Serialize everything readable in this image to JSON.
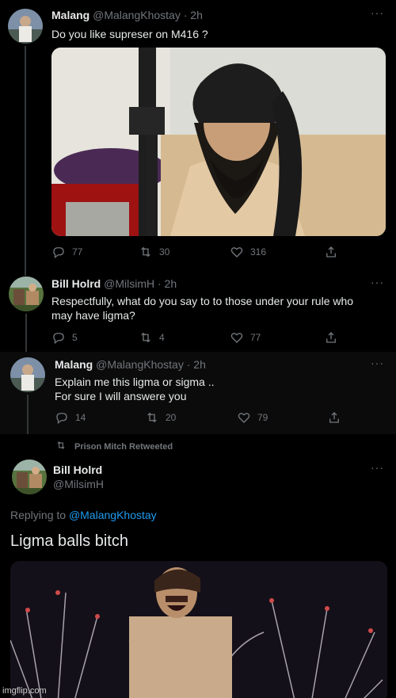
{
  "tweet1": {
    "name": "Malang",
    "handle": "@MalangKhostay",
    "time": "· 2h",
    "text": "Do you like supreser on M416 ?",
    "replies": "77",
    "retweets": "30",
    "likes": "316"
  },
  "tweet2": {
    "name": "Bill Holrd",
    "handle": "@MilsimH",
    "time": "· 2h",
    "text_line1": "Respectfully, what do you say to to those under your rule who",
    "text_line2": "may have ligma?",
    "replies": "5",
    "retweets": "4",
    "likes": "77"
  },
  "tweet3": {
    "name": "Malang",
    "handle": "@MalangKhostay",
    "time": "· 2h",
    "text_line1": "Explain me this ligma or sigma ..",
    "text_line2": "For sure I will answere you",
    "replies": "14",
    "retweets": "20",
    "likes": "79"
  },
  "retweet_banner": "Prison Mitch Retweeted",
  "tweet4": {
    "name": "Bill Holrd",
    "handle": "@MilsimH",
    "replying_prefix": "Replying to",
    "replying_to": "@MalangKhostay",
    "text": "Ligma balls bitch"
  },
  "watermark": "imgflip.com",
  "colors": {
    "background": "#000000",
    "text": "#e7e9ea",
    "secondary": "#71767b",
    "link": "#1d9bf0"
  },
  "icons": [
    "reply-icon",
    "retweet-icon",
    "like-icon",
    "share-icon",
    "more-icon"
  ]
}
